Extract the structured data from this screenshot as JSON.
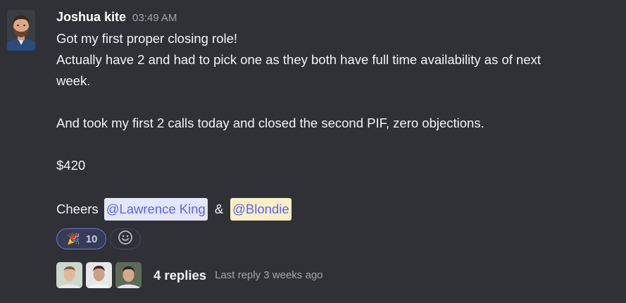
{
  "message": {
    "author": "Joshua kite",
    "timestamp": "03:49 AM",
    "lines": [
      "Got my first proper closing role!",
      "Actually have 2 and had to pick one as they both have full time availability as of next",
      "week.",
      "",
      "And took my first 2 calls today and closed the second PIF, zero objections.",
      "",
      "$420",
      ""
    ],
    "cheers_prefix": "Cheers",
    "mention_1": "@Lawrence King",
    "ampersand": "&",
    "mention_2": "@Blondie"
  },
  "reactions": {
    "emoji": "🎉",
    "emoji_icon": "party-popper-icon",
    "count": "10",
    "add_icon": "smiley-icon"
  },
  "thread": {
    "replies_label": "4 replies",
    "last_reply": "Last reply 3 weeks ago"
  },
  "colors": {
    "background": "#2f3136",
    "mention_1_bg": "#e4e6fb",
    "mention_2_bg": "#fcefc7",
    "mention_text": "#5865f2",
    "reaction_border": "#6b74d6"
  }
}
